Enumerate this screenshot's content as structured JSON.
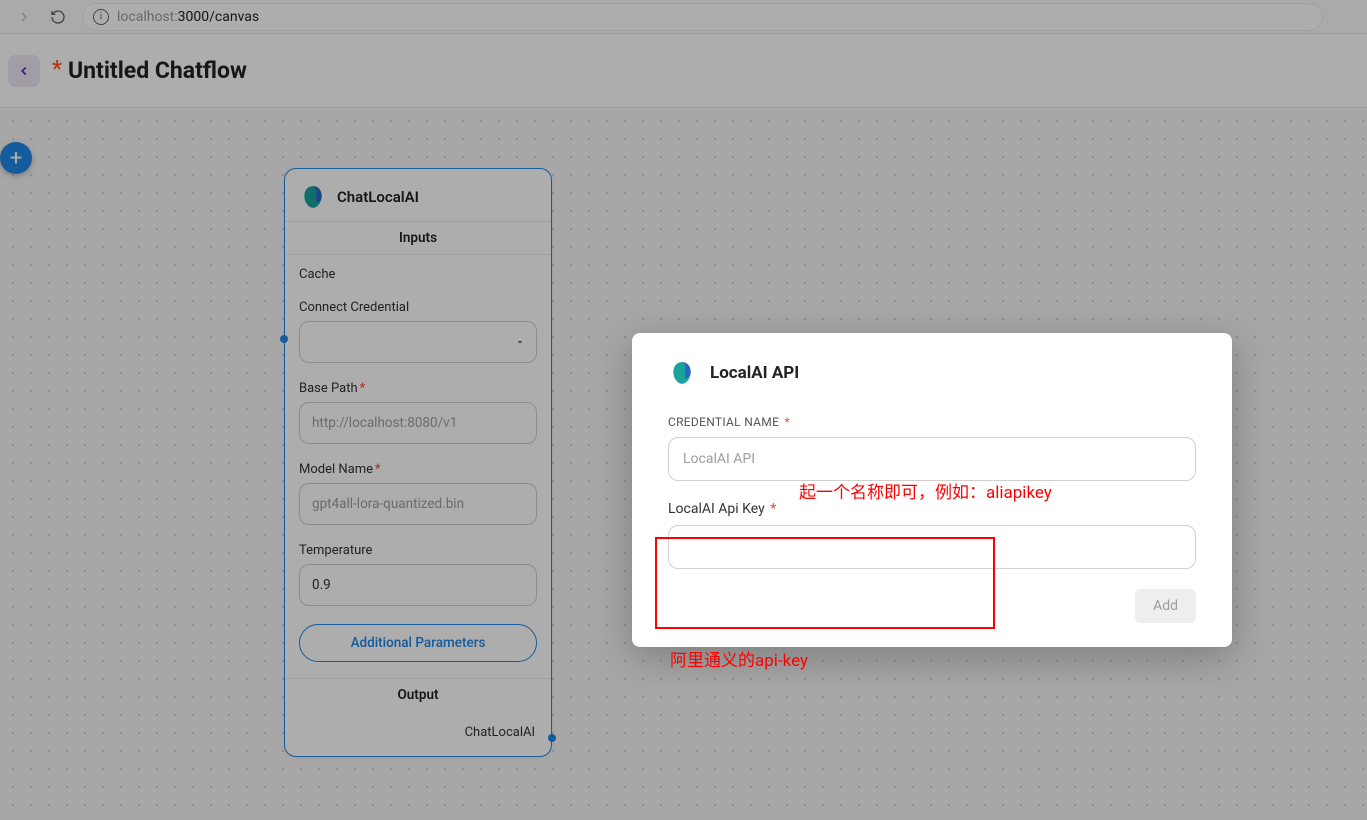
{
  "browser": {
    "url_host": "localhost:",
    "url_port_path": "3000/canvas"
  },
  "header": {
    "asterisk": "*",
    "title": "Untitled Chatflow"
  },
  "fab": {
    "plus": "+"
  },
  "node": {
    "title": "ChatLocalAI",
    "inputs_label": "Inputs",
    "output_label": "Output",
    "output_name": "ChatLocalAI",
    "fields": {
      "cache_label": "Cache",
      "credential_label": "Connect Credential",
      "base_path_label": "Base Path",
      "base_path_required": "*",
      "base_path_placeholder": "http://localhost:8080/v1",
      "model_label": "Model Name",
      "model_required": "*",
      "model_placeholder": "gpt4all-lora-quantized.bin",
      "temperature_label": "Temperature",
      "temperature_value": "0.9",
      "additional_label": "Additional Parameters"
    }
  },
  "dialog": {
    "title": "LocalAI API",
    "cred_name_label": "CREDENTIAL NAME",
    "cred_name_required": "*",
    "cred_name_placeholder": "LocalAI API",
    "api_key_label": "LocalAI Api Key",
    "api_key_required": "*",
    "add_button": "Add"
  },
  "annotations": {
    "cred_hint": "起一个名称即可，例如：aliapikey",
    "api_hint": "阿里通义的api-key"
  }
}
